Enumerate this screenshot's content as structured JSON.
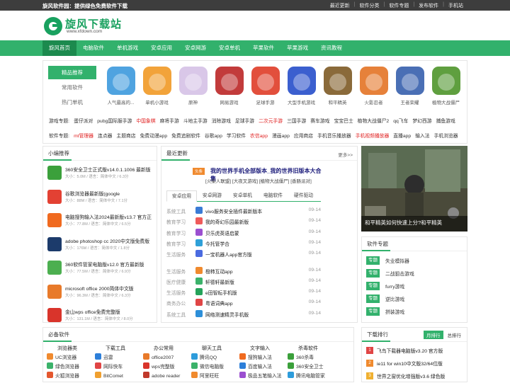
{
  "topbar": {
    "title": "旋风软件园：提供绿色免费软件下载",
    "links": [
      "最近更新",
      "软件分类",
      "软件专题",
      "发布软件",
      "手机站"
    ]
  },
  "logo": {
    "name": "旋风下载站",
    "url": "www.xfdown.com"
  },
  "nav": [
    "旋风首页",
    "电脑软件",
    "单机游戏",
    "安卓应用",
    "安卓网游",
    "安卓单机",
    "苹果软件",
    "苹果游戏",
    "资讯教程"
  ],
  "category": {
    "side": [
      "精品推荐",
      "常用软件",
      "热门单机"
    ],
    "apps": [
      {
        "label": "人气最高的...",
        "color": "#4fa3e0"
      },
      {
        "label": "单机小游戏",
        "color": "#f2a33a"
      },
      {
        "label": "原神",
        "color": "#d9c7e8"
      },
      {
        "label": "网易游戏",
        "color": "#c23b3b"
      },
      {
        "label": "足球手游",
        "color": "#e24f3c"
      },
      {
        "label": "大型手机游戏",
        "color": "#3b5fcf"
      },
      {
        "label": "和平精英",
        "color": "#8a6a3a"
      },
      {
        "label": "火影忍者",
        "color": "#e6813a"
      },
      {
        "label": "王者荣耀",
        "color": "#4a6fb5"
      },
      {
        "label": "植物大战僵尸",
        "color": "#5f9f3f"
      }
    ],
    "game_topics": {
      "head": "游戏专题:",
      "items": [
        "蛋仔派对",
        "pubg国际服手游",
        "中国象棋",
        "麻将手游",
        "斗地主手游",
        "消除游戏",
        "足球手游",
        "二次元手游",
        "三国手游",
        "赛车游戏",
        "宝宝巴士",
        "植物大战僵尸2",
        "qq飞车",
        "梦幻西游",
        "捕鱼游戏"
      ],
      "red": [
        2,
        7
      ]
    },
    "soft_topics": {
      "head": "软件专题:",
      "items": [
        "mt管理器",
        "连点器",
        "主题商店",
        "免费动漫app",
        "免费追剧软件",
        "谷歌app",
        "学习软件",
        "农信app",
        "漫画app",
        "应用商店",
        "手机音乐播放器",
        "手机视频播放器",
        "直播app",
        "输入法",
        "手机浏览器"
      ],
      "red": [
        0,
        7,
        11
      ]
    }
  },
  "recommend": {
    "title": "小编推荐",
    "items": [
      {
        "name": "360安全卫士正式版v14.0.1.1006 最新版",
        "meta": "大小：5.0M / 语言：简体中文 / 6.3分",
        "color": "#3ba03b"
      },
      {
        "name": "谷歌浏览器最新版(google",
        "meta": "大小：88M / 语言：简体中文 / 7.1分",
        "color": "#e34133"
      },
      {
        "name": "电脑搜狗输入法2024最新版v13.7 官方正",
        "meta": "大小：77.8M / 语言：简体中文 / 6.5分",
        "color": "#f06a1f"
      },
      {
        "name": "adobe photoshop cc 2020中文版免费版",
        "meta": "大小：176M / 语言：简体中文 / 1.8分",
        "color": "#1c3b6b"
      },
      {
        "name": "360软件管家电脑版v12.0 官方最新版",
        "meta": "大小：77.5M / 语言：简体中文 / 6.9分",
        "color": "#4caf50"
      },
      {
        "name": "microsoft office 2000简体中文版",
        "meta": "大小：96.3M / 语言：简体中文 / 6.3分",
        "color": "#e87a2a"
      },
      {
        "name": "金山wps office免费完整版",
        "meta": "大小：131.1M / 语言：简体中文 / 8.0分",
        "color": "#d9342b"
      }
    ]
  },
  "latest": {
    "title": "最近更新",
    "more": "更多>>",
    "headline": {
      "badge": "头条",
      "title": "我的世界手机全部版本_我的世界旧版本大合集",
      "links": "[火柴人联盟] [大夜叉游戏] [植物大战僵尸] [香肠派对]"
    },
    "tabs": [
      "安卓应用",
      "安卓网游",
      "安卓单机",
      "电脑软件",
      "硬件驱动"
    ],
    "rows": [
      {
        "cat": "系统工具",
        "name": "vivo服务安全插件最新版本",
        "date": "09-14",
        "color": "#3a7bd5"
      },
      {
        "cat": "教育学习",
        "name": "我的奇幻乐园最新版",
        "date": "09-14",
        "color": "#ef5a5a"
      },
      {
        "cat": "教育学习",
        "name": "贝乐虎英语启蒙",
        "date": "09-14",
        "color": "#9b4fd0"
      },
      {
        "cat": "教育学习",
        "name": "今托管学合",
        "date": "09-14",
        "color": "#2fa0d8"
      },
      {
        "cat": "生活服务",
        "name": "一宝机器人app官方版",
        "date": "09-14",
        "color": "#4a6be0"
      },
      {
        "cat": "生活服务",
        "name": "橙柿互动app",
        "date": "09-14",
        "color": "#f08a2e"
      },
      {
        "cat": "医疗健康",
        "name": "轩德轩最新版",
        "date": "09-14",
        "color": "#3bb26a"
      },
      {
        "cat": "生活服务",
        "name": "e田智耘手机版",
        "date": "09-14",
        "color": "#25a35a"
      },
      {
        "cat": "商务办公",
        "name": "粤语词典app",
        "date": "09-14",
        "color": "#e04545"
      },
      {
        "cat": "系统工具",
        "name": "网络测速精灵手机版",
        "date": "09-14",
        "color": "#2d8fd9"
      }
    ]
  },
  "banner": {
    "caption": "和平精英如何快速上分?和平精英"
  },
  "special": {
    "title": "软件专题",
    "badge": "专题",
    "items": [
      "失业模拟器",
      "二战狙击游戏",
      "furry游戏",
      "逆比游戏",
      "拼装游戏"
    ]
  },
  "must": {
    "title": "必备软件",
    "cols": [
      {
        "head": "浏览器类",
        "items": [
          {
            "t": "UC浏览器",
            "c": "#f08a2e"
          },
          {
            "t": "绿色浏览器",
            "c": "#3bb26a"
          },
          {
            "t": "火狐浏览器",
            "c": "#e4572e"
          }
        ]
      },
      {
        "head": "下载工具",
        "items": [
          {
            "t": "迅雷",
            "c": "#2d7fd9"
          },
          {
            "t": "网际快车",
            "c": "#e04545"
          },
          {
            "t": "BitComet",
            "c": "#f0a030"
          }
        ]
      },
      {
        "head": "办公常用",
        "items": [
          {
            "t": "office2007",
            "c": "#e87a2a"
          },
          {
            "t": "wps完整版",
            "c": "#d9342b"
          },
          {
            "t": "adobe reader",
            "c": "#c0392b"
          }
        ]
      },
      {
        "head": "聊天工具",
        "items": [
          {
            "t": "腾讯QQ",
            "c": "#2d9cdb"
          },
          {
            "t": "微信电脑版",
            "c": "#3bb26a"
          },
          {
            "t": "阿里旺旺",
            "c": "#f08a2e"
          }
        ]
      },
      {
        "head": "文字输入",
        "items": [
          {
            "t": "搜狗输入法",
            "c": "#f06a1f"
          },
          {
            "t": "百度输入法",
            "c": "#2d7fd9"
          },
          {
            "t": "极品五笔输入法",
            "c": "#9b4fd0"
          }
        ]
      },
      {
        "head": "杀毒软件",
        "items": [
          {
            "t": "360杀毒",
            "c": "#3ba03b"
          },
          {
            "t": "360安全卫士",
            "c": "#3ba03b"
          },
          {
            "t": "腾讯电脑管家",
            "c": "#2d9cdb"
          }
        ]
      }
    ]
  },
  "rank": {
    "title": "下载排行",
    "tabs": [
      "月排行",
      "总排行"
    ],
    "items": [
      {
        "no": "1",
        "name": "飞鸟下载器电脑版v3.20 官方版",
        "color": "#e04545"
      },
      {
        "no": "2",
        "name": "ie11 for win10中文版32/64位版",
        "color": "#f08a2e"
      },
      {
        "no": "3",
        "name": "世界之窗优化增强版v3.6 绿色版",
        "color": "#f0b030"
      }
    ]
  }
}
